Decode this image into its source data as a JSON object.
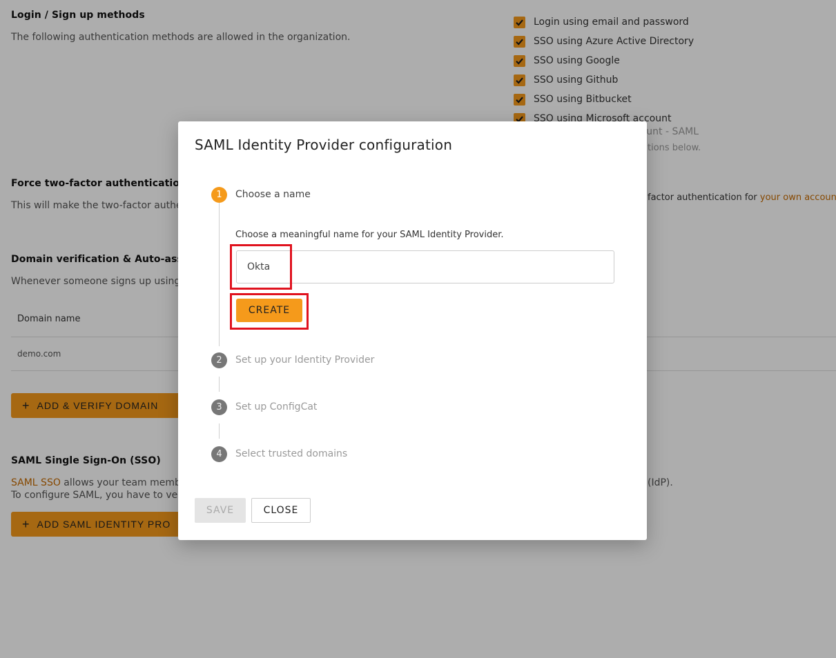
{
  "background": {
    "login_methods": {
      "title": "Login / Sign up methods",
      "description": "The following authentication methods are allowed in the organization.",
      "options": [
        {
          "label": "Login using email and password",
          "checked": true
        },
        {
          "label": "SSO using Azure Active Directory",
          "checked": true
        },
        {
          "label": "SSO using Google",
          "checked": true
        },
        {
          "label": "SSO using Github",
          "checked": true
        },
        {
          "label": "SSO using Bitbucket",
          "checked": true
        },
        {
          "label": "SSO using Microsoft account",
          "checked": true
        }
      ],
      "partial_option": "count - SAML",
      "partial_note": "tions below."
    },
    "two_factor": {
      "title": "Force two-factor authentication",
      "description_left": "This will make the two-factor authe",
      "description_right": "factor authentication for ",
      "link": "your own account"
    },
    "domain": {
      "title": "Domain verification & Auto-assig",
      "description": "Whenever someone signs up using",
      "column_header": "Domain name",
      "rows": [
        "demo.com"
      ],
      "add_button": "ADD & VERIFY DOMAIN"
    },
    "saml": {
      "title": "SAML Single Sign-On (SSO)",
      "link": "SAML SSO",
      "description_1": " allows your team memb",
      "description_2": "To configure SAML, you have to ver",
      "description_right": "(IdP).",
      "add_button": "ADD SAML IDENTITY PRO"
    }
  },
  "modal": {
    "title": "SAML Identity Provider configuration",
    "steps": [
      {
        "number": "1",
        "label": "Choose a name",
        "state": "active"
      },
      {
        "number": "2",
        "label": "Set up your Identity Provider",
        "state": "inactive"
      },
      {
        "number": "3",
        "label": "Set up ConfigCat",
        "state": "inactive"
      },
      {
        "number": "4",
        "label": "Select trusted domains",
        "state": "inactive"
      }
    ],
    "step1_description": "Choose a meaningful name for your SAML Identity Provider.",
    "name_input_value": "Okta",
    "create_label": "CREATE",
    "save_label": "SAVE",
    "close_label": "CLOSE"
  },
  "colors": {
    "accent": "#f59a1b",
    "link": "#c66a00",
    "highlight": "#e0121e",
    "inactive_step": "#777777"
  }
}
